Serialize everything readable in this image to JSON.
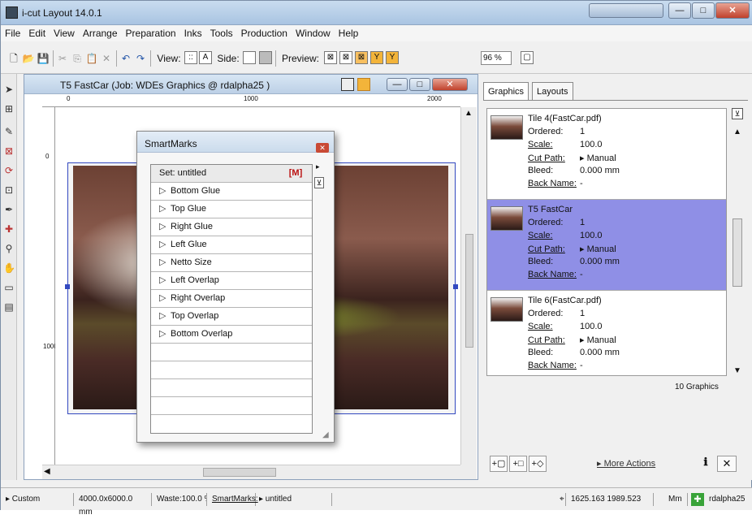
{
  "app": {
    "title": "i-cut Layout 14.0.1"
  },
  "menu": [
    "File",
    "Edit",
    "View",
    "Arrange",
    "Preparation",
    "Inks",
    "Tools",
    "Production",
    "Window",
    "Help"
  ],
  "toolbar": {
    "view_label": "View:",
    "side_label": "Side:",
    "preview_label": "Preview:",
    "zoom_value": "96 %"
  },
  "document": {
    "title": "T5 FastCar (Job: WDEs Graphics @ rdalpha25 )",
    "ruler_ticks": [
      "0",
      "1000",
      "2000"
    ],
    "vruler_ticks": [
      "0",
      "1000"
    ]
  },
  "smartmarks": {
    "title": "SmartMarks",
    "set_label": "Set: untitled",
    "items": [
      "Bottom Glue",
      "Top Glue",
      "Right Glue",
      "Left Glue",
      "Netto Size",
      "Left Overlap",
      "Right Overlap",
      "Top Overlap",
      "Bottom Overlap"
    ],
    "m_button": "[M]"
  },
  "right_panel": {
    "tabs": [
      "Graphics",
      "Layouts"
    ],
    "field_labels": {
      "ordered": "Ordered:",
      "scale": "Scale:",
      "cut_path": "Cut Path:",
      "bleed": "Bleed:",
      "back_name": "Back Name:"
    },
    "graphics": [
      {
        "name": "Tile 4(FastCar.pdf)",
        "ordered": "1",
        "scale": "100.0",
        "cut_path": "▸ Manual",
        "bleed": "0.000 mm",
        "back_name": "-"
      },
      {
        "name": "T5 FastCar",
        "ordered": "1",
        "scale": "100.0",
        "cut_path": "▸ Manual",
        "bleed": "0.000 mm",
        "back_name": "-"
      },
      {
        "name": "Tile 6(FastCar.pdf)",
        "ordered": "1",
        "scale": "100.0",
        "cut_path": "▸ Manual",
        "bleed": "0.000 mm",
        "back_name": "-"
      }
    ],
    "count": "10 Graphics",
    "more_actions": "▸ More Actions"
  },
  "status": {
    "custom": "▸ Custom",
    "size": "4000.0x6000.0 mm",
    "waste": "Waste:100.0 %",
    "smartmarks_link": "SmartMarks:",
    "smartmarks_set": "▸ untitled",
    "coords": "1625.163  1989.523",
    "units": "Mm",
    "user": "rdalpha25"
  },
  "colors": {
    "selection": "#8f8fe6",
    "sheet_border": "#3349c0"
  }
}
